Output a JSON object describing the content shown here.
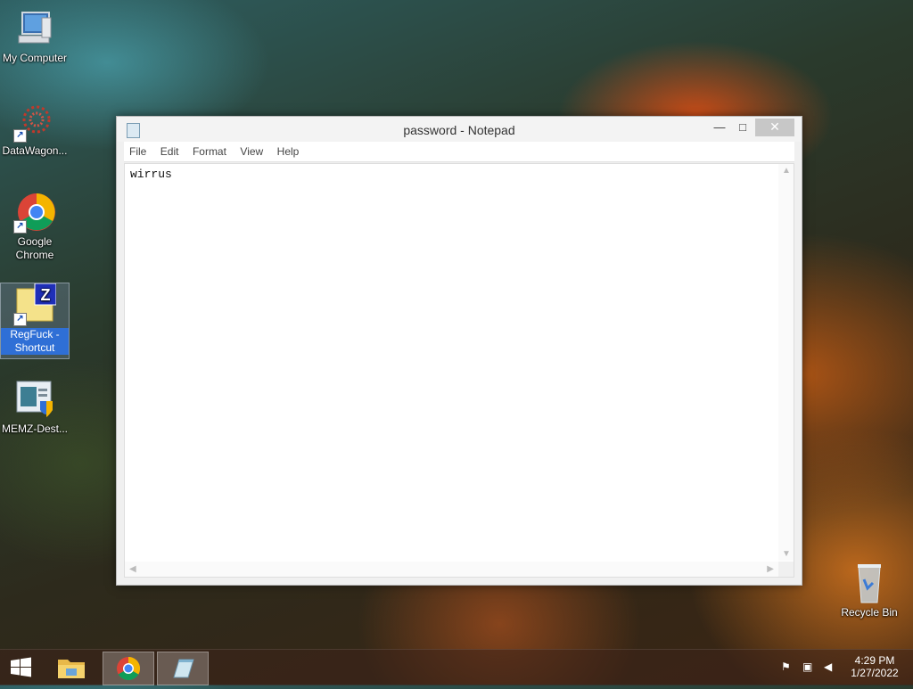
{
  "desktop": {
    "icons": [
      {
        "label": "My Computer"
      },
      {
        "label": "DataWagon..."
      },
      {
        "label": "Google Chrome"
      },
      {
        "label": "RegFuck - Shortcut"
      },
      {
        "label": "MEMZ-Dest..."
      },
      {
        "label": "Recycle Bin"
      }
    ]
  },
  "notepad": {
    "title": "password - Notepad",
    "controls": {
      "minimize": "—",
      "maximize": "□",
      "close": "✕"
    },
    "menus": [
      "File",
      "Edit",
      "Format",
      "View",
      "Help"
    ],
    "content": "wirrus"
  },
  "taskbar": {
    "items": [
      "start-button",
      "file-explorer",
      "google-chrome",
      "notepad"
    ],
    "clock": {
      "time": "4:29 PM",
      "date": "1/27/2022"
    }
  }
}
